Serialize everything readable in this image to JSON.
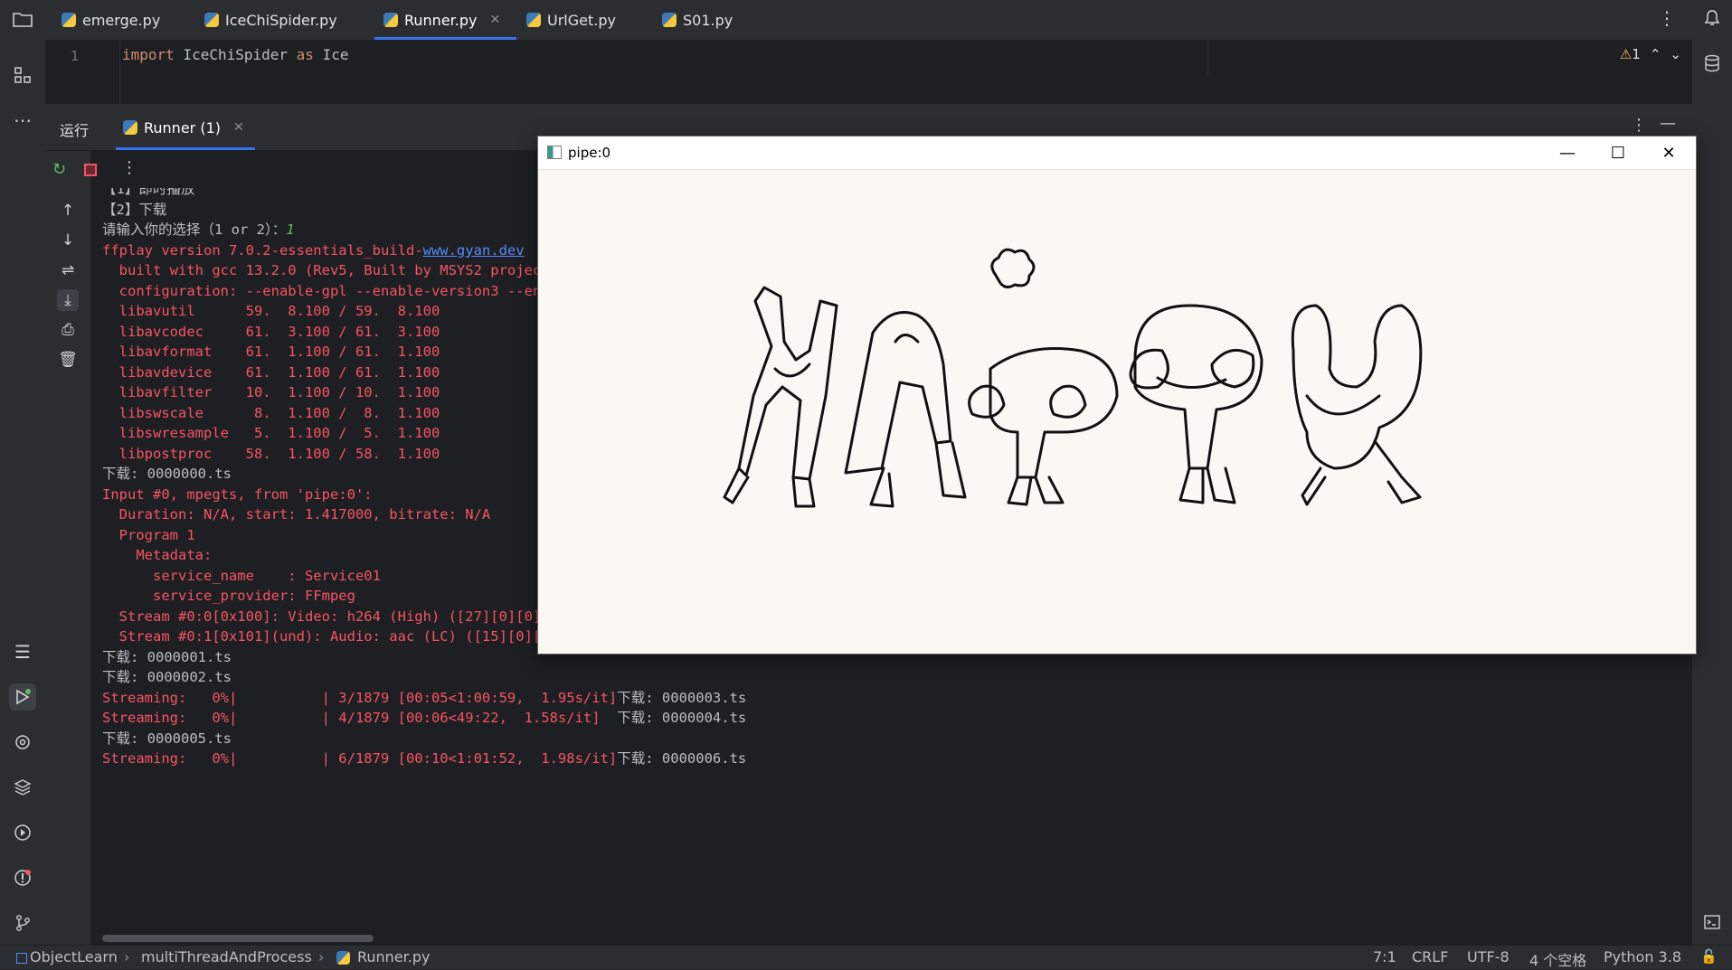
{
  "tabs": [
    {
      "label": "emerge.py"
    },
    {
      "label": "IceChiSpider.py"
    },
    {
      "label": "Runner.py",
      "active": true
    },
    {
      "label": "UrlGet.py"
    },
    {
      "label": "S01.py"
    }
  ],
  "editor": {
    "line_number": "1",
    "code_import": "import",
    "code_module": "IceChiSpider",
    "code_as": "as",
    "code_alias": "Ice",
    "warning_count": "1"
  },
  "run_panel": {
    "label": "运行",
    "tab_label": "Runner (1)"
  },
  "console": {
    "lines": [
      {
        "text": "【1】即时播放",
        "style": "w"
      },
      {
        "text": "【2】下载",
        "style": "w"
      },
      {
        "text": "请输入你的选择（1 or 2）：",
        "style": "w",
        "input": "1"
      },
      {
        "text": "ffplay version 7.0.2-essentials_build-",
        "style": "r",
        "link": "www.gyan.dev"
      },
      {
        "text": "  built with gcc 13.2.0 (Rev5, Built by MSYS2 project)",
        "style": "r"
      },
      {
        "text": "  configuration: --enable-gpl --enable-version3 --enable-static",
        "style": "r"
      },
      {
        "text": "  libavutil      59.  8.100 / 59.  8.100",
        "style": "r"
      },
      {
        "text": "  libavcodec     61.  3.100 / 61.  3.100",
        "style": "r"
      },
      {
        "text": "  libavformat    61.  1.100 / 61.  1.100",
        "style": "r"
      },
      {
        "text": "  libavdevice    61.  1.100 / 61.  1.100",
        "style": "r"
      },
      {
        "text": "  libavfilter    10.  1.100 / 10.  1.100",
        "style": "r"
      },
      {
        "text": "  libswscale      8.  1.100 /  8.  1.100",
        "style": "r"
      },
      {
        "text": "  libswresample   5.  1.100 /  5.  1.100",
        "style": "r"
      },
      {
        "text": "  libpostproc    58.  1.100 / 58.  1.100",
        "style": "r"
      },
      {
        "text": "下载: 0000000.ts",
        "style": "w"
      },
      {
        "text": "Input #0, mpegts, from 'pipe:0':",
        "style": "r"
      },
      {
        "text": "  Duration: N/A, start: 1.417000, bitrate: N/A",
        "style": "r"
      },
      {
        "text": "  Program 1",
        "style": "r"
      },
      {
        "text": "    Metadata:",
        "style": "r"
      },
      {
        "text": "      service_name    : Service01",
        "style": "r"
      },
      {
        "text": "      service_provider: FFmpeg",
        "style": "r"
      },
      {
        "text": "  Stream #0:0[0x100]: Video: h264 (High) ([27][0][0][0] / 0x001B), yuv420p(progressive), 1280x536 [SAR 1:1 DAR 160:67], 25 fps, 25 tbr, 90k tbn",
        "style": "r"
      },
      {
        "text": "  Stream #0:1[0x101](und): Audio: aac (LC) ([15][0][0][0] / 0x000F), 44100 Hz, stereo, fltp, 85 kb/s",
        "style": "r"
      },
      {
        "text": "下载: 0000001.ts",
        "style": "w"
      },
      {
        "text": "下载: 0000002.ts",
        "style": "w"
      },
      {
        "text": "Streaming:   0%|          | 3/1879 [00:05<1:00:59,  1.95s/it]",
        "style": "r",
        "suffix": "下载: 0000003.ts"
      },
      {
        "text": "Streaming:   0%|          | 4/1879 [00:06<49:22,  1.58s/it]  ",
        "style": "r",
        "suffix": "下载: 0000004.ts"
      },
      {
        "text": "下载: 0000005.ts",
        "style": "w"
      },
      {
        "text": "Streaming:   0%|          | 6/1879 [00:10<1:01:52,  1.98s/it]",
        "style": "r",
        "suffix": "下载: 0000006.ts"
      }
    ]
  },
  "video_window": {
    "title": "pipe:0",
    "minimize": "—",
    "maximize": "☐",
    "close": "✕",
    "frame_text": "HAPPY"
  },
  "status_bar": {
    "breadcrumb": [
      "ObjectLearn",
      "multiThreadAndProcess",
      "Runner.py"
    ],
    "position": "7:1",
    "line_sep": "CRLF",
    "encoding": "UTF-8",
    "indent": "4 个空格",
    "interpreter": "Python 3.8"
  },
  "colors": {
    "accent": "#3574f0",
    "error_text": "#f75464",
    "input_text": "#5fb865"
  }
}
